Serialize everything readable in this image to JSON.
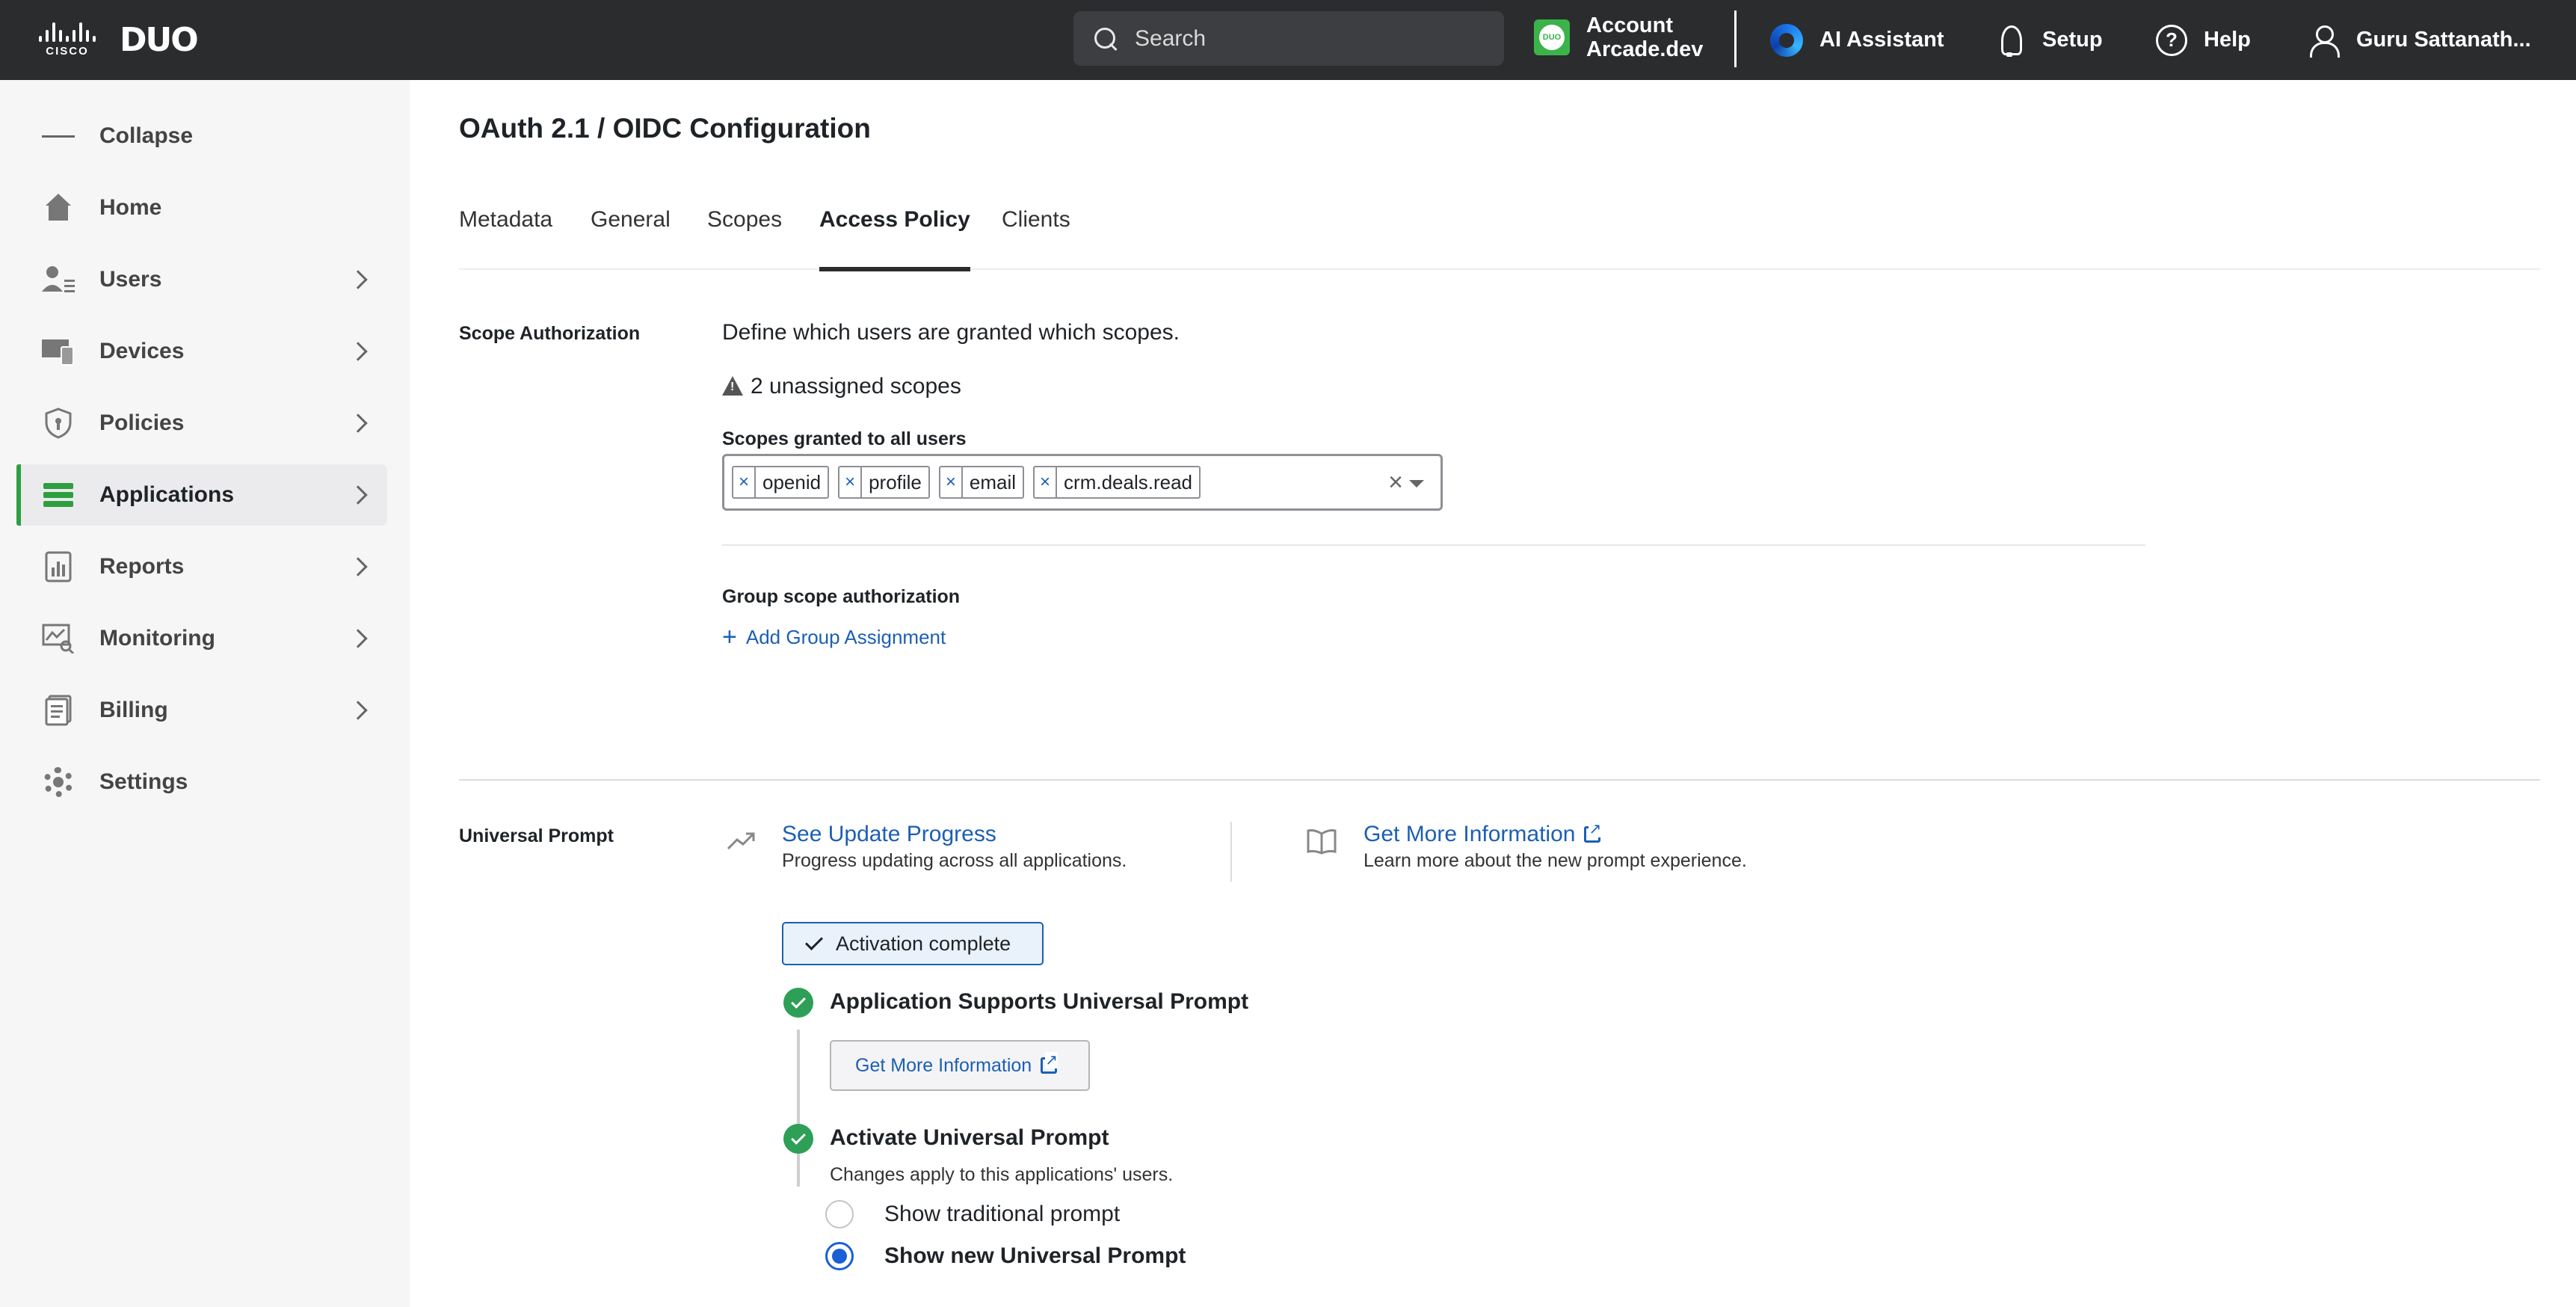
{
  "topbar": {
    "cisco_word": "CISCO",
    "duo_word": "DUO",
    "search_placeholder": "Search",
    "account_line1": "Account",
    "account_line2": "Arcade.dev",
    "ai_assistant": "AI Assistant",
    "setup": "Setup",
    "help": "Help",
    "user_name": "Guru Sattanath..."
  },
  "sidebar": {
    "items": [
      {
        "label": "Collapse",
        "icon": "menu-icon"
      },
      {
        "label": "Home",
        "icon": "home-icon"
      },
      {
        "label": "Users",
        "icon": "users-icon"
      },
      {
        "label": "Devices",
        "icon": "devices-icon"
      },
      {
        "label": "Policies",
        "icon": "shield-icon"
      },
      {
        "label": "Applications",
        "icon": "applications-icon",
        "active": true
      },
      {
        "label": "Reports",
        "icon": "reports-icon"
      },
      {
        "label": "Monitoring",
        "icon": "monitoring-icon"
      },
      {
        "label": "Billing",
        "icon": "billing-icon"
      },
      {
        "label": "Settings",
        "icon": "gear-icon"
      }
    ]
  },
  "main": {
    "title": "OAuth 2.1 / OIDC Configuration",
    "tabs": [
      {
        "label": "Metadata"
      },
      {
        "label": "General"
      },
      {
        "label": "Scopes"
      },
      {
        "label": "Access Policy",
        "active": true
      },
      {
        "label": "Clients"
      }
    ],
    "scope_authorization": {
      "label": "Scope Authorization",
      "description": "Define which users are granted which scopes.",
      "warning": "2 unassigned scopes",
      "granted_label": "Scopes granted to all users",
      "scopes": [
        "openid",
        "profile",
        "email",
        "crm.deals.read"
      ],
      "chip_remove": "×",
      "clear": "×",
      "group_label": "Group scope authorization",
      "add_group": "Add Group Assignment"
    },
    "universal_prompt": {
      "label": "Universal Prompt",
      "update_link": "See Update Progress",
      "update_sub": "Progress updating across all applications.",
      "info_link": "Get More Information",
      "info_sub": "Learn more about the new prompt experience.",
      "activation": "Activation complete",
      "step1_title": "Application Supports Universal Prompt",
      "step1_button": "Get More Information",
      "step2_title": "Activate Universal Prompt",
      "step2_sub": "Changes apply to this applications' users.",
      "radio_traditional": "Show traditional prompt",
      "radio_new": "Show new Universal Prompt",
      "selected": "new"
    }
  },
  "colors": {
    "topbar_bg": "#2b2c2e",
    "accent_green": "#2e9f3e",
    "link_blue": "#1c5fb3",
    "radio_blue": "#1a5fd6"
  }
}
